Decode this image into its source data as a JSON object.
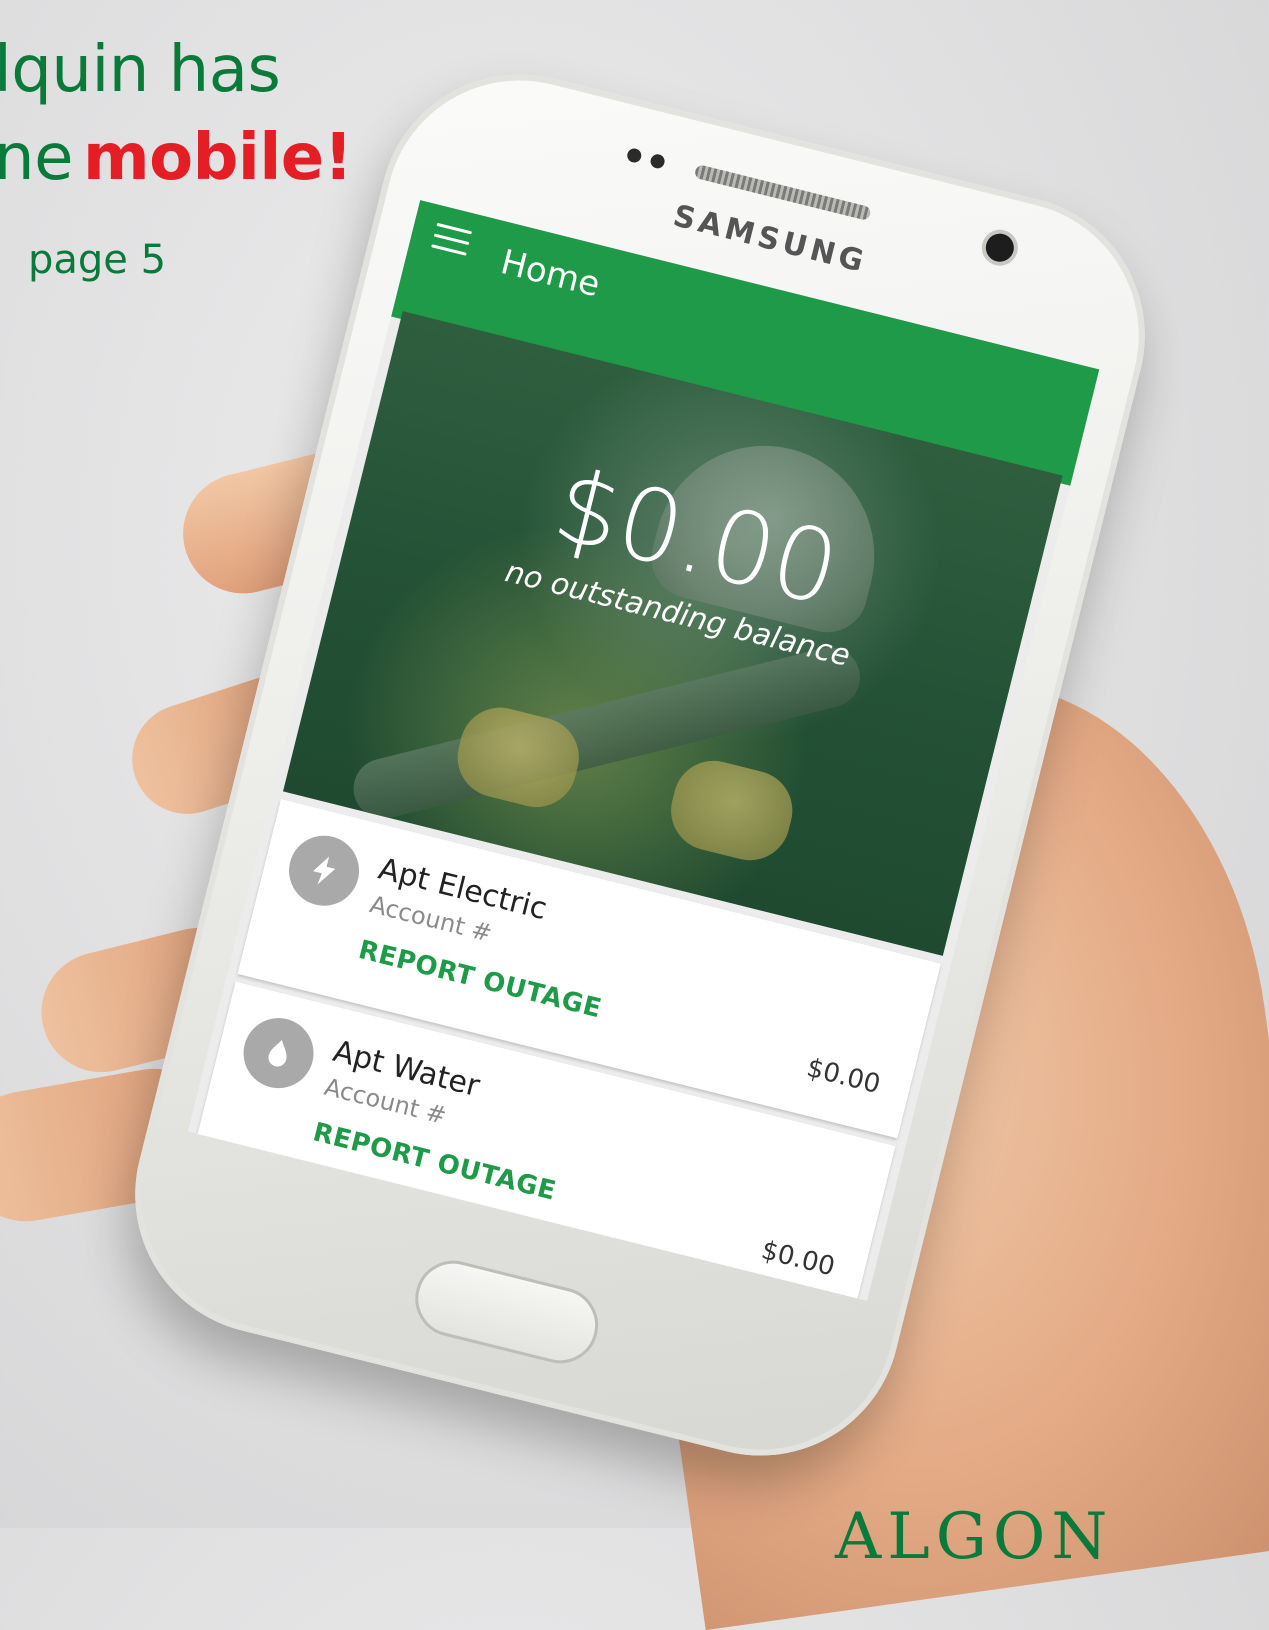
{
  "headline": {
    "line1": "lquin has",
    "line2_prefix": "ne",
    "line2_accent": "mobile!",
    "line3": "page 5"
  },
  "phone": {
    "brand": "SAMSUNG",
    "app": {
      "title": "Home",
      "balance": {
        "amount": "$0.00",
        "label": "no outstanding balance"
      },
      "accounts": [
        {
          "name": "Apt Electric",
          "number_label": "Account #",
          "action": "REPORT OUTAGE",
          "amount": "$0.00",
          "icon": "lightning-bolt-icon"
        },
        {
          "name": "Apt Water",
          "number_label": "Account #",
          "action": "REPORT OUTAGE",
          "amount": "$0.00",
          "icon": "water-drop-icon"
        }
      ]
    }
  },
  "logo": {
    "text": "ALGON"
  },
  "colors": {
    "brand_green": "#1f9a48",
    "headline_green": "#0a7a3b",
    "accent_red": "#e51e25",
    "icon_gray": "#a9a9a9"
  }
}
